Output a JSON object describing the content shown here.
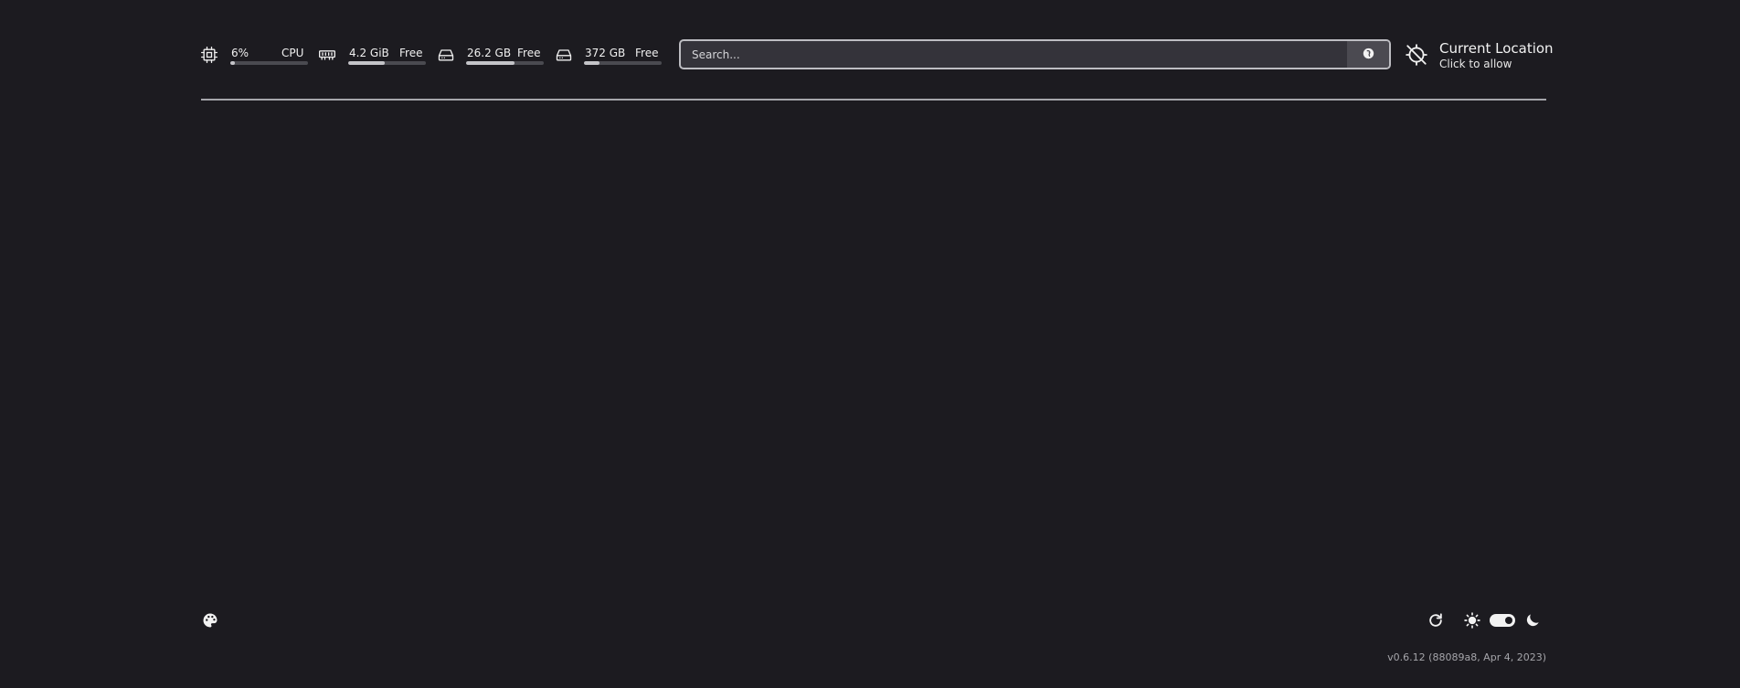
{
  "resources": {
    "cpu": {
      "value": "6%",
      "label": "CPU",
      "usage_fraction": 0.06
    },
    "memory": {
      "value": "4.2 GiB",
      "label": "Free",
      "usage_fraction": 0.47
    },
    "disk1": {
      "value": "26.2 GB",
      "label": "Free",
      "usage_fraction": 0.62
    },
    "disk2": {
      "value": "372 GB",
      "label": "Free",
      "usage_fraction": 0.2
    }
  },
  "search": {
    "placeholder": "Search...",
    "value": "",
    "engine_icon": "duckduckgo-icon"
  },
  "location": {
    "title": "Current Location",
    "subtitle": "Click to allow",
    "icon": "location-off-icon"
  },
  "footer": {
    "theme_icon": "palette-icon",
    "refresh_icon": "refresh-icon",
    "light_icon": "sun-icon",
    "dark_icon": "moon-icon",
    "dark_mode_enabled": true,
    "version": "v0.6.12 (88089a8, Apr 4, 2023)"
  },
  "colors": {
    "background": "#1c1b20",
    "text": "#eeeeee",
    "bar_track": "#4a4a50",
    "bar_fill": "#c4c4c8",
    "search_bg": "#34333a",
    "divider": "#a5a5aa"
  }
}
